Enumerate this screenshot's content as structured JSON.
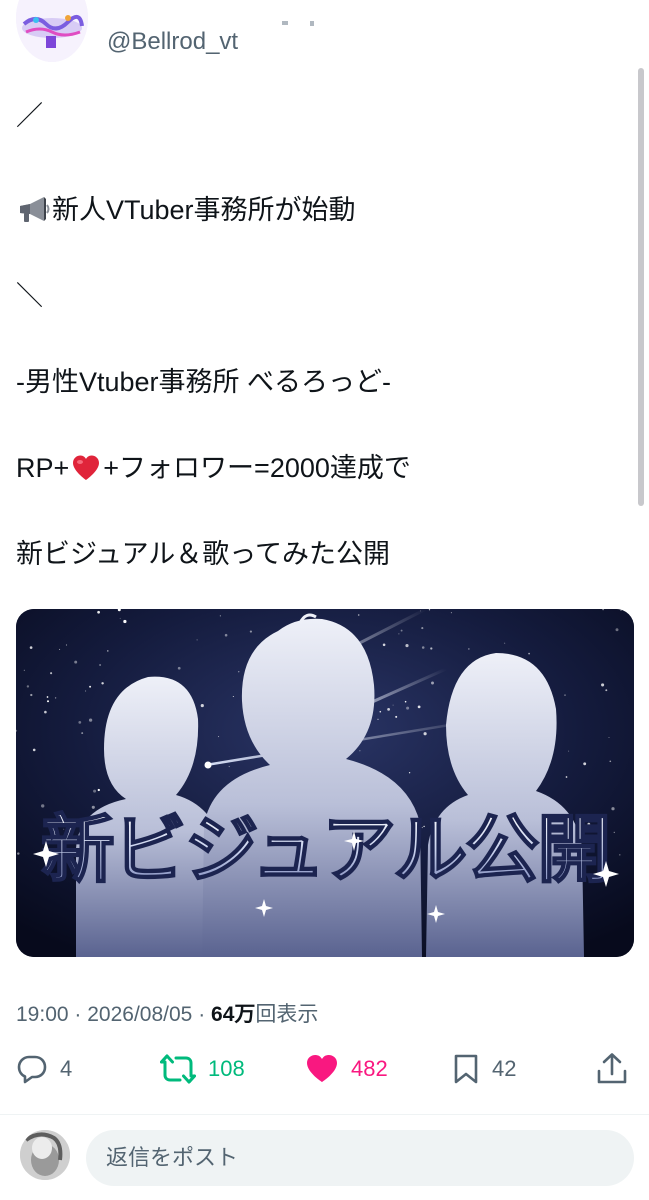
{
  "header": {
    "handle": "@Bellrod_vt"
  },
  "tweet": {
    "lines": [
      "／",
      "新人VTuber事務所が始動",
      "＼",
      "-男性Vtuber事務所 べるろっど-",
      "RP+",
      "+フォロワー=2000達成で",
      "新ビジュアル＆歌ってみた公開"
    ],
    "emoji": {
      "line1": "megaphone-emoji",
      "line4": "red-heart-emoji"
    }
  },
  "media": {
    "banner_text": "新ビジュアル公開",
    "description_colors": {
      "sky": "#0b1024",
      "silhouette": "#c9cde0",
      "text": "#dfe3f2"
    }
  },
  "meta": {
    "time": "19:00",
    "separator": "·",
    "date": "2026/08/05",
    "views_count": "64万",
    "views_label": "回表示"
  },
  "actions": {
    "replies": "4",
    "reposts": "108",
    "likes": "482",
    "bookmarks": "42",
    "colors": {
      "repost": "#00ba7c",
      "like": "#f91880",
      "neutral": "#536471"
    }
  },
  "reply_bar": {
    "placeholder": "返信をポスト"
  }
}
